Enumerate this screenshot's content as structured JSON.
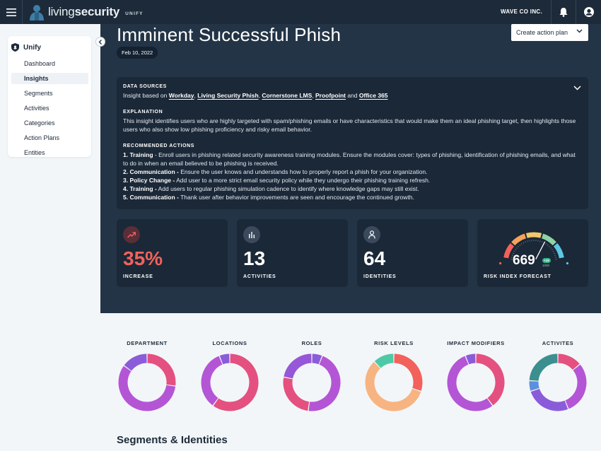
{
  "topbar": {
    "brand_name_light": "living",
    "brand_name_bold": "security",
    "brand_sub": "UNIFY",
    "org": "WAVE CO INC."
  },
  "sidebar": {
    "header": "Unify",
    "items": [
      {
        "label": "Dashboard",
        "active": false
      },
      {
        "label": "Insights",
        "active": true
      },
      {
        "label": "Segments",
        "active": false
      },
      {
        "label": "Activities",
        "active": false
      },
      {
        "label": "Categories",
        "active": false
      },
      {
        "label": "Action Plans",
        "active": false
      },
      {
        "label": "Entities",
        "active": false
      }
    ]
  },
  "page": {
    "title": "Imminent Successful Phish",
    "date": "Feb 10, 2022",
    "action_button": "Create action plan"
  },
  "info": {
    "data_sources_heading": "DATA SOURCES",
    "data_sources_prefix": "Insight based on",
    "sources": [
      "Workday",
      "Living Security Phish",
      "Cornerstone LMS",
      "Proofpoint",
      "Office 365"
    ],
    "data_sources_and": "and",
    "explanation_heading": "EXPLANATION",
    "explanation": "This insight identifies users who are highly targeted with spam/phishing emails or have characteristics that would make them an ideal phishing target, then highlights those users who also show low phishing proficiency and risky email behavior.",
    "actions_heading": "RECOMMENDED ACTIONS",
    "actions": [
      {
        "lead": "1. Training",
        "text": " - Enroll users in phishing related security awareness training modules. Ensure the modules cover: types of phishing, identification of phishing emails, and what to do in when an email believed to be phishing is received."
      },
      {
        "lead": "2. Communication -",
        "text": " Ensure the user knows and understands how to properly report a phish for your organization."
      },
      {
        "lead": "3. Policy Change -",
        "text": " Add user to a more strict email security policy while they undergo their phishing training refresh."
      },
      {
        "lead": "4. Training -",
        "text": " Add users to regular phishing simulation cadence to identify where knowledge gaps may still exist."
      },
      {
        "lead": "5. Communication -",
        "text": " Thank user after behavior improvements are seen and encourage the continued growth."
      }
    ]
  },
  "stats": [
    {
      "value": "35%",
      "label": "INCREASE",
      "icon": "trending-up-icon"
    },
    {
      "value": "13",
      "label": "ACTIVITIES",
      "icon": "bar-chart-icon"
    },
    {
      "value": "64",
      "label": "IDENTITIES",
      "icon": "person-icon"
    }
  ],
  "risk": {
    "value": "669",
    "badge": "+19",
    "max": "1000",
    "label": "RISK INDEX FORECAST",
    "level": 0.669,
    "colors": [
      "#f2625b",
      "#f5a35a",
      "#f1c96b",
      "#8ed3a6",
      "#5cc8e6"
    ]
  },
  "donuts": [
    {
      "title": "DEPARTMENT",
      "segments": [
        {
          "value": 0.27,
          "color": "#e4507f"
        },
        {
          "value": 0.58,
          "color": "#b455d6"
        },
        {
          "value": 0.15,
          "color": "#8b5cd9"
        }
      ]
    },
    {
      "title": "LOCATIONS",
      "segments": [
        {
          "value": 0.6,
          "color": "#e4507f"
        },
        {
          "value": 0.34,
          "color": "#b455d6"
        },
        {
          "value": 0.06,
          "color": "#8b5cd9"
        }
      ]
    },
    {
      "title": "ROLES",
      "segments": [
        {
          "value": 0.06,
          "color": "#8b5cd9"
        },
        {
          "value": 0.46,
          "color": "#b455d6"
        },
        {
          "value": 0.26,
          "color": "#e4507f"
        },
        {
          "value": 0.22,
          "color": "#9657d8"
        }
      ]
    },
    {
      "title": "RISK LEVELS",
      "segments": [
        {
          "value": 0.3,
          "color": "#f2625b"
        },
        {
          "value": 0.58,
          "color": "#f7b481"
        },
        {
          "value": 0.12,
          "color": "#4ec9a6"
        }
      ]
    },
    {
      "title": "IMPACT MODIFIERS",
      "segments": [
        {
          "value": 0.4,
          "color": "#e4507f"
        },
        {
          "value": 0.54,
          "color": "#b455d6"
        },
        {
          "value": 0.06,
          "color": "#8b5cd9"
        }
      ]
    },
    {
      "title": "ACTIVITES",
      "segments": [
        {
          "value": 0.14,
          "color": "#e4507f"
        },
        {
          "value": 0.3,
          "color": "#b455d6"
        },
        {
          "value": 0.26,
          "color": "#8b5cd9"
        },
        {
          "value": 0.06,
          "color": "#5c8fe0"
        },
        {
          "value": 0.24,
          "color": "#3c8f8f"
        }
      ]
    }
  ],
  "segments_heading": "Segments & Identities"
}
